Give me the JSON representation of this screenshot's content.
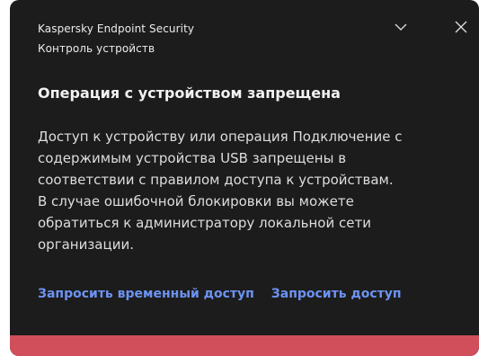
{
  "notification": {
    "app_name": "Kaspersky Endpoint Security",
    "component": "Контроль устройств",
    "collapse_icon": "chevron-down-icon",
    "close_icon": "close-icon",
    "title": "Операция с устройством запрещена",
    "message_lines": [
      "Доступ к устройству или операция Подключение с",
      "содержимым устройства USB запрещены в",
      "соответствии с правилом доступа к устройствам.",
      "В случае ошибочной блокировки вы можете",
      "обратиться к администратору локальной сети",
      "организации."
    ],
    "actions": {
      "request_temporary": "Запросить временный доступ",
      "request_access": "Запросить доступ"
    },
    "colors": {
      "background": "#1c1c1c",
      "link": "#6d93f2",
      "status_strip": "#d04f5a"
    }
  }
}
